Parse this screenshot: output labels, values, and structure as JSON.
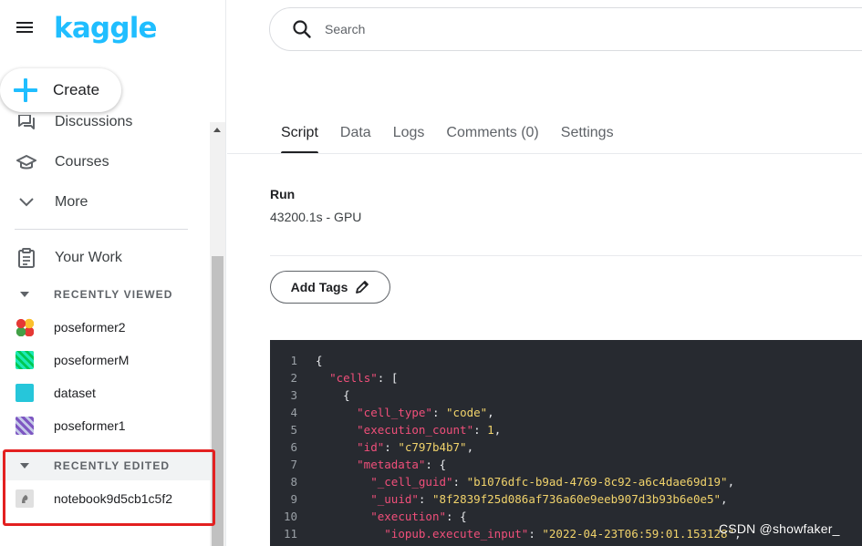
{
  "sidebar": {
    "logo": "kaggle",
    "create_label": "Create",
    "nav": [
      {
        "label": "Discussions",
        "icon": "discussions-icon"
      },
      {
        "label": "Courses",
        "icon": "courses-icon"
      },
      {
        "label": "More",
        "icon": "chevron-down-icon"
      },
      {
        "label": "Your Work",
        "icon": "clipboard-icon"
      }
    ],
    "recently_viewed_label": "RECENTLY VIEWED",
    "recently_viewed": [
      {
        "label": "poseformer2"
      },
      {
        "label": "poseformerM"
      },
      {
        "label": "dataset"
      },
      {
        "label": "poseformer1"
      }
    ],
    "recently_edited_label": "RECENTLY EDITED",
    "recently_edited": [
      {
        "label": "notebook9d5cb1c5f2"
      }
    ]
  },
  "search": {
    "placeholder": "Search"
  },
  "tabs": [
    {
      "label": "Script",
      "active": true
    },
    {
      "label": "Data",
      "active": false
    },
    {
      "label": "Logs",
      "active": false
    },
    {
      "label": "Comments (0)",
      "active": false
    },
    {
      "label": "Settings",
      "active": false
    }
  ],
  "run": {
    "label": "Run",
    "value": "43200.1s - GPU"
  },
  "add_tags_label": "Add Tags",
  "code": {
    "line_numbers": [
      "1",
      "2",
      "3",
      "4",
      "5",
      "6",
      "7",
      "8",
      "9",
      "10",
      "11"
    ],
    "lines": [
      {
        "indent": "",
        "key": "",
        "value": "",
        "open": "{"
      },
      {
        "indent": "  ",
        "key": "\"cells\"",
        "value": "",
        "open": "["
      },
      {
        "indent": "    ",
        "key": "",
        "value": "",
        "open": "{"
      },
      {
        "indent": "      ",
        "key": "\"cell_type\"",
        "value": "\"code\"",
        "open": ","
      },
      {
        "indent": "      ",
        "key": "\"execution_count\"",
        "value": "1",
        "open": ","
      },
      {
        "indent": "      ",
        "key": "\"id\"",
        "value": "\"c797b4b7\"",
        "open": ","
      },
      {
        "indent": "      ",
        "key": "\"metadata\"",
        "value": "",
        "open": "{"
      },
      {
        "indent": "        ",
        "key": "\"_cell_guid\"",
        "value": "\"b1076dfc-b9ad-4769-8c92-a6c4dae69d19\"",
        "open": ","
      },
      {
        "indent": "        ",
        "key": "\"_uuid\"",
        "value": "\"8f2839f25d086af736a60e9eeb907d3b93b6e0e5\"",
        "open": ","
      },
      {
        "indent": "        ",
        "key": "\"execution\"",
        "value": "",
        "open": "{"
      },
      {
        "indent": "          ",
        "key": "\"iopub.execute_input\"",
        "value": "\"2022-04-23T06:59:01.153128\"",
        "open": ","
      }
    ]
  },
  "watermark": "CSDN @showfaker_",
  "colors": {
    "brand": "#20beff",
    "highlight_box": "#e32020",
    "code_bg": "#272a30",
    "code_key": "#f04f7a",
    "code_value": "#f1d36b"
  }
}
